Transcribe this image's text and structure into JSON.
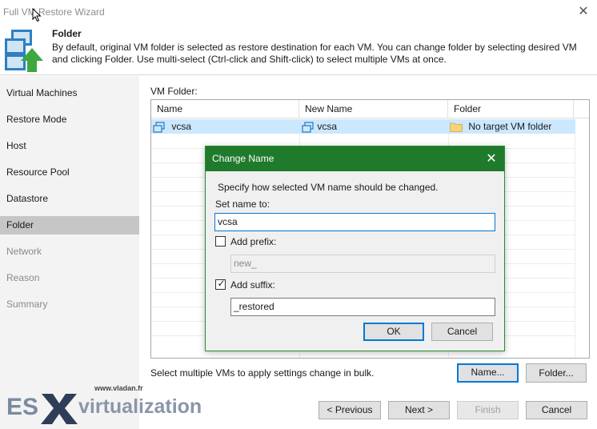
{
  "window": {
    "title": "Full VM Restore Wizard"
  },
  "header": {
    "title": "Folder",
    "description": "By default, original VM folder is selected as restore destination for each VM. You can change folder by selecting desired VM and clicking Folder. Use multi-select (Ctrl-click and Shift-click) to select multiple VMs at once."
  },
  "sidebar": {
    "items": [
      {
        "label": "Virtual Machines",
        "state": "normal"
      },
      {
        "label": "Restore Mode",
        "state": "normal"
      },
      {
        "label": "Host",
        "state": "normal"
      },
      {
        "label": "Resource Pool",
        "state": "normal"
      },
      {
        "label": "Datastore",
        "state": "normal"
      },
      {
        "label": "Folder",
        "state": "active"
      },
      {
        "label": "Network",
        "state": "disabled"
      },
      {
        "label": "Reason",
        "state": "disabled"
      },
      {
        "label": "Summary",
        "state": "disabled"
      }
    ]
  },
  "main": {
    "vm_folder_label": "VM Folder:",
    "columns": [
      "Name",
      "New Name",
      "Folder"
    ],
    "rows": [
      {
        "name": "vcsa",
        "new_name": "vcsa",
        "folder": "No target VM folder"
      }
    ],
    "hint": "Select multiple VMs to apply settings change in bulk.",
    "name_button": "Name...",
    "folder_button": "Folder..."
  },
  "dialog": {
    "title": "Change Name",
    "instruction": "Specify how selected VM name should be changed.",
    "set_name_label": "Set name to:",
    "set_name_value": "vcsa",
    "add_prefix_label": "Add prefix:",
    "add_prefix_checked": false,
    "prefix_value": "new_",
    "add_suffix_label": "Add suffix:",
    "add_suffix_checked": true,
    "suffix_value": "_restored",
    "ok_label": "OK",
    "cancel_label": "Cancel"
  },
  "footer": {
    "previous": "< Previous",
    "next": "Next >",
    "finish": "Finish",
    "cancel": "Cancel"
  },
  "watermark": {
    "site": "www.vladan.fr",
    "brand_left": "ES",
    "brand_right": "virtualization"
  },
  "colors": {
    "dialog_title_bg": "#207a2c",
    "selection_bg": "#cce8ff",
    "accent": "#0078d7",
    "sidebar_bg": "#f3f3f3",
    "sidebar_active": "#c6c6c6"
  }
}
